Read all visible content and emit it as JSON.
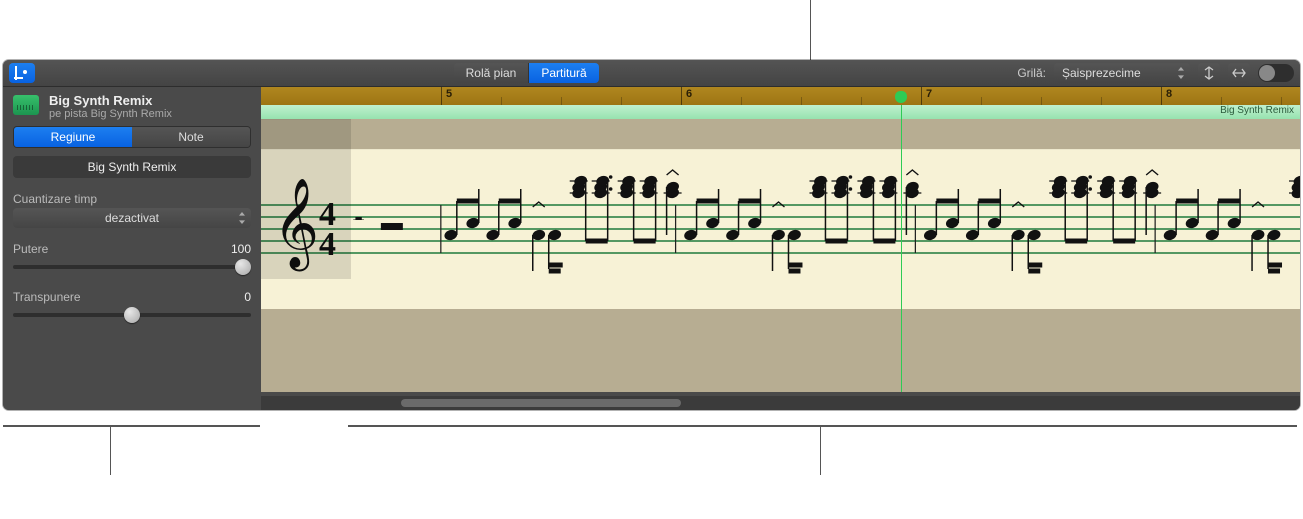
{
  "topbar": {
    "view_tabs": {
      "roll": "Rolă pian",
      "score": "Partitură"
    },
    "grid_label": "Grilă:",
    "grid_value": "Șaisprezecime"
  },
  "inspector": {
    "track_title": "Big Synth Remix",
    "track_sub": "pe pista Big Synth Remix",
    "tabs": {
      "region": "Regiune",
      "note": "Note"
    },
    "region_name": "Big Synth Remix",
    "quantize_label": "Cuantizare timp",
    "quantize_value": "dezactivat",
    "strength_label": "Putere",
    "strength_value": "100",
    "transpose_label": "Transpunere",
    "transpose_value": "0"
  },
  "score": {
    "region_name": "Big Synth Remix",
    "ruler_bars": [
      "5",
      "6",
      "7",
      "8"
    ],
    "time_sig": {
      "top": "4",
      "bottom": "4"
    }
  }
}
